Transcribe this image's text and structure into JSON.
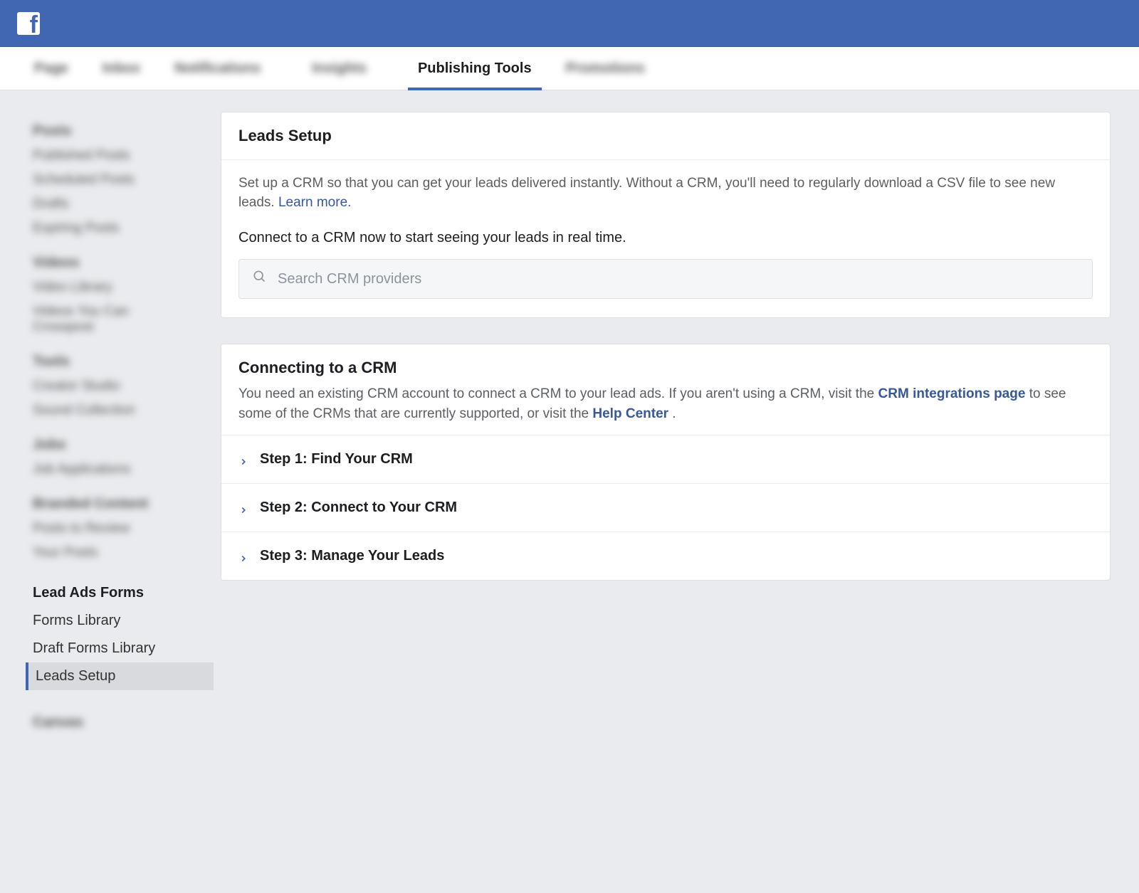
{
  "header": {
    "logo_letter": "f"
  },
  "tabs": {
    "blurred": [
      "Page",
      "Inbox",
      "Notifications",
      "Insights"
    ],
    "active": "Publishing Tools",
    "blurred_after": [
      "Promotions"
    ]
  },
  "sidebar": {
    "lead_ads_heading": "Lead Ads Forms",
    "items": [
      {
        "label": "Forms Library",
        "active": false
      },
      {
        "label": "Draft Forms Library",
        "active": false
      },
      {
        "label": "Leads Setup",
        "active": true
      }
    ]
  },
  "leads_card": {
    "title": "Leads Setup",
    "intro": "Set up a CRM so that you can get your leads delivered instantly. Without a CRM, you'll need to regularly download a CSV file to see new leads. ",
    "learn_more": "Learn more.",
    "connect_prompt": "Connect to a CRM now to start seeing your leads in real time.",
    "search_placeholder": "Search CRM providers"
  },
  "crm_card": {
    "title": "Connecting to a CRM",
    "body_pre": "You need an existing CRM account to connect a CRM to your lead ads. If you aren't using a CRM, visit the ",
    "link1": "CRM integrations page",
    "body_mid": " to see some of the CRMs that are currently supported, or visit the ",
    "link2": "Help Center",
    "body_post": " .",
    "steps": [
      "Step 1: Find Your CRM",
      "Step 2: Connect to Your CRM",
      "Step 3: Manage Your Leads"
    ]
  }
}
